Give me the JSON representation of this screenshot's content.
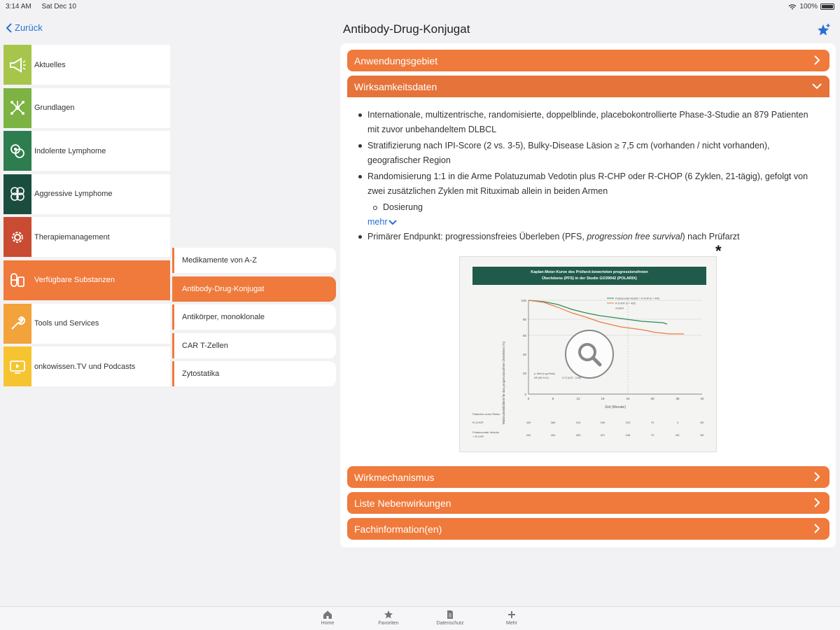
{
  "status": {
    "time": "3:14 AM",
    "date": "Sat Dec 10",
    "battery": "100%"
  },
  "nav": {
    "back": "Zurück",
    "title": "Antibody-Drug-Konjugat"
  },
  "colors": {
    "accent": "#ef7a3c",
    "link": "#2a6fd6",
    "dark_green": "#1f5a4b"
  },
  "menu": [
    {
      "label": "Aktuelles",
      "color": "#a6c64b",
      "icon": "megaphone-icon"
    },
    {
      "label": "Grundlagen",
      "color": "#7cb342",
      "icon": "network-icon"
    },
    {
      "label": "Indolente Lymphome",
      "color": "#2e7d4f",
      "icon": "cells-icon"
    },
    {
      "label": "Aggressive Lymphome",
      "color": "#1b4d3e",
      "icon": "cells-dense-icon"
    },
    {
      "label": "Therapiemanagement",
      "color": "#c94b32",
      "icon": "gear-icon"
    },
    {
      "label": "Verfügbare Substanzen",
      "color": "#ef7a3c",
      "icon": "pills-icon"
    },
    {
      "label": "Tools und Services",
      "color": "#f2a33a",
      "icon": "wrench-icon"
    },
    {
      "label": "onkowissen.TV und Podcasts",
      "color": "#f6c431",
      "icon": "tv-icon"
    }
  ],
  "submenu": [
    {
      "label": "Medikamente von A-Z"
    },
    {
      "label": "Antibody-Drug-Konjugat"
    },
    {
      "label": "Antikörper, monoklonale"
    },
    {
      "label": "CAR T-Zellen"
    },
    {
      "label": "Zytostatika"
    }
  ],
  "accordion": {
    "anwendungsgebiet": "Anwendungsgebiet",
    "wirksamkeitsdaten": "Wirksamkeitsdaten",
    "wirkmechanismus": "Wirkmechanismus",
    "nebenwirkungen": "Liste Nebenwirkungen",
    "fachinformation": "Fachinformation(en)"
  },
  "content": {
    "b1": "Internationale, multizentrische, randomisierte, doppelblinde, placebokontrollierte Phase-3-Studie an 879 Patienten mit zuvor unbehandeltem DLBCL",
    "b2": "Stratifizierung nach IPI-Score (2 vs. 3-5), Bulky-Disease Läsion ≥ 7,5 cm (vorhanden / nicht vorhanden), geografischer Region",
    "b3": "Randomisierung 1:1 in die Arme Polatuzumab Vedotin plus R-CHP oder R-CHOP (6 Zyklen, 21-tägig), gefolgt von zwei zusätzlichen Zyklen mit Rituximab allein in beiden Armen",
    "sub1": "Dosierung",
    "mehr": "mehr",
    "b4_pre": "Primärer Endpunkt: progressionsfreies Überleben (PFS, ",
    "b4_italic": "progression free survival",
    "b4_post": ") nach Prüfarzt",
    "asterisk": "*"
  },
  "figure": {
    "header_line1": "Kaplan-Meier-Kurve des Prüfarzt-bewerteten progressionsfreien",
    "header_line2": "Überlebens (PFS) in der Studie GO39942 (POLARIX)",
    "ylabel": "Wahrscheinlichkeit für das progressionsfreie Überleben (%)",
    "xlabel": "Zeit (Monate)",
    "legend1": "Polatuzumab Vedotin + R-CHP (n = 440)",
    "legend2": "R-CHOP (n = 439)",
    "legend3": "zensiert",
    "risk_header": "Patienten unter Risiko",
    "risk_row1": "R-CHOP",
    "risk_row2a": "Polatuzumab Vedotin",
    "risk_row2b": "+ R-CHP",
    "yticks": [
      "100",
      "80",
      "60",
      "40",
      "20",
      "0"
    ],
    "xticks": [
      "0",
      "6",
      "12",
      "18",
      "24",
      "30",
      "36",
      "42"
    ],
    "risk1": [
      "439",
      "389",
      "310",
      "296",
      "220",
      "79",
      "3",
      "NE"
    ],
    "risk2": [
      "440",
      "404",
      "353",
      "327",
      "248",
      "79",
      "NE",
      "NE"
    ],
    "note1": "p: Wert (Log-Rank)",
    "note2": "HR (95 % KI)",
    "note3": "0,73 (0,57 - 0,95)"
  },
  "tabs": [
    {
      "label": "Home",
      "icon": "home-icon"
    },
    {
      "label": "Favoriten",
      "icon": "star-icon"
    },
    {
      "label": "Datenschutz",
      "icon": "document-icon"
    },
    {
      "label": "Mehr",
      "icon": "plus-icon"
    }
  ]
}
